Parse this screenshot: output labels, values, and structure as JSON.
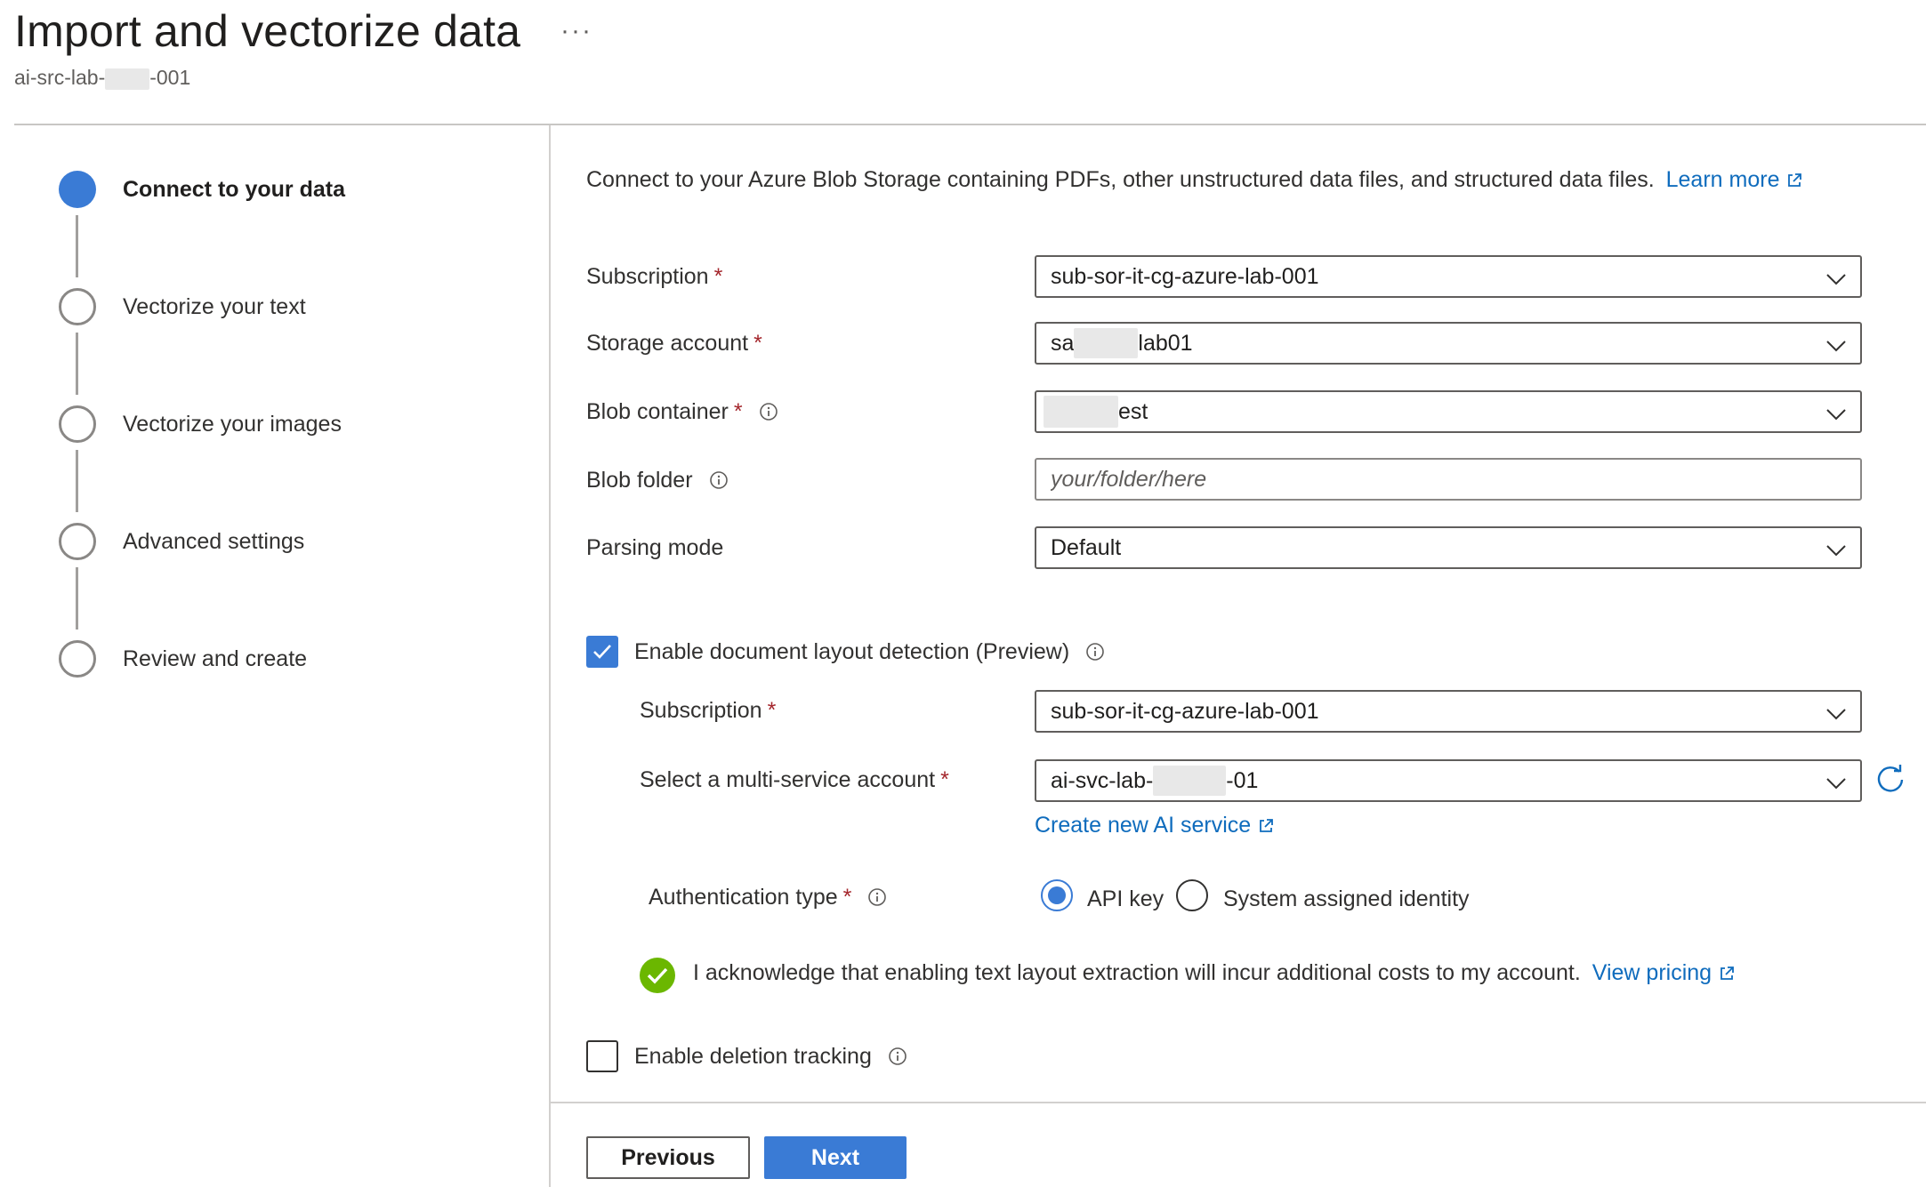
{
  "header": {
    "title": "Import and vectorize data",
    "more_label": "···",
    "subtitle_prefix": "ai-src-lab-",
    "subtitle_suffix": "-001"
  },
  "steps": [
    {
      "label": "Connect to your data",
      "state": "active"
    },
    {
      "label": "Vectorize your text",
      "state": "pending"
    },
    {
      "label": "Vectorize your images",
      "state": "pending"
    },
    {
      "label": "Advanced settings",
      "state": "pending"
    },
    {
      "label": "Review and create",
      "state": "pending"
    }
  ],
  "intro": {
    "text": "Connect to your Azure Blob Storage containing PDFs, other unstructured data files, and structured data files.",
    "link": "Learn more"
  },
  "form": {
    "subscription": {
      "label": "Subscription",
      "required": "*",
      "value": "sub-sor-it-cg-azure-lab-001"
    },
    "storage_account": {
      "label": "Storage account",
      "required": "*",
      "value_prefix": "sa",
      "value_suffix": "lab01"
    },
    "blob_container": {
      "label": "Blob container",
      "required": "*",
      "value_suffix": "est"
    },
    "blob_folder": {
      "label": "Blob folder",
      "placeholder": "your/folder/here"
    },
    "parsing_mode": {
      "label": "Parsing mode",
      "value": "Default"
    }
  },
  "layout_detection": {
    "label": "Enable document layout detection (Preview)",
    "checked": true,
    "subscription": {
      "label": "Subscription",
      "required": "*",
      "value": "sub-sor-it-cg-azure-lab-001"
    },
    "account": {
      "label": "Select a multi-service account",
      "required": "*",
      "value_prefix": "ai-svc-lab-",
      "value_suffix": "-01"
    },
    "create_link": "Create new AI service",
    "auth": {
      "label": "Authentication type",
      "required": "*",
      "options": [
        "API key",
        "System assigned identity"
      ],
      "selected": "API key"
    },
    "ack": {
      "text": "I acknowledge that enabling text layout extraction will incur additional costs to my account.",
      "link": "View pricing"
    }
  },
  "deletion_tracking": {
    "label": "Enable deletion tracking",
    "checked": false
  },
  "buttons": {
    "previous": "Previous",
    "next": "Next"
  },
  "colors": {
    "accent": "#3a7bd5",
    "link": "#0f6cbd",
    "required": "#a4262c",
    "success": "#6bb700"
  }
}
